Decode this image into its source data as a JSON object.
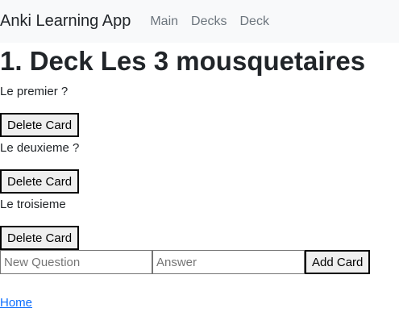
{
  "navbar": {
    "brand": "Anki Learning App",
    "links": [
      "Main",
      "Decks",
      "Deck"
    ]
  },
  "page": {
    "title": "1. Deck Les 3 mousquetaires"
  },
  "cards": [
    {
      "question": "Le premier ?",
      "delete_label": "Delete Card"
    },
    {
      "question": "Le deuxieme ?",
      "delete_label": "Delete Card"
    },
    {
      "question": "Le troisieme",
      "delete_label": "Delete Card"
    }
  ],
  "add_form": {
    "question_placeholder": "New Question",
    "question_value": "",
    "answer_placeholder": "Answer",
    "answer_value": "",
    "add_label": "Add Card"
  },
  "footer": {
    "home_link": "Home"
  },
  "colors": {
    "navbar_bg": "#f8f9fa",
    "link": "#0d6efd",
    "nav_link": "#6c757d"
  }
}
